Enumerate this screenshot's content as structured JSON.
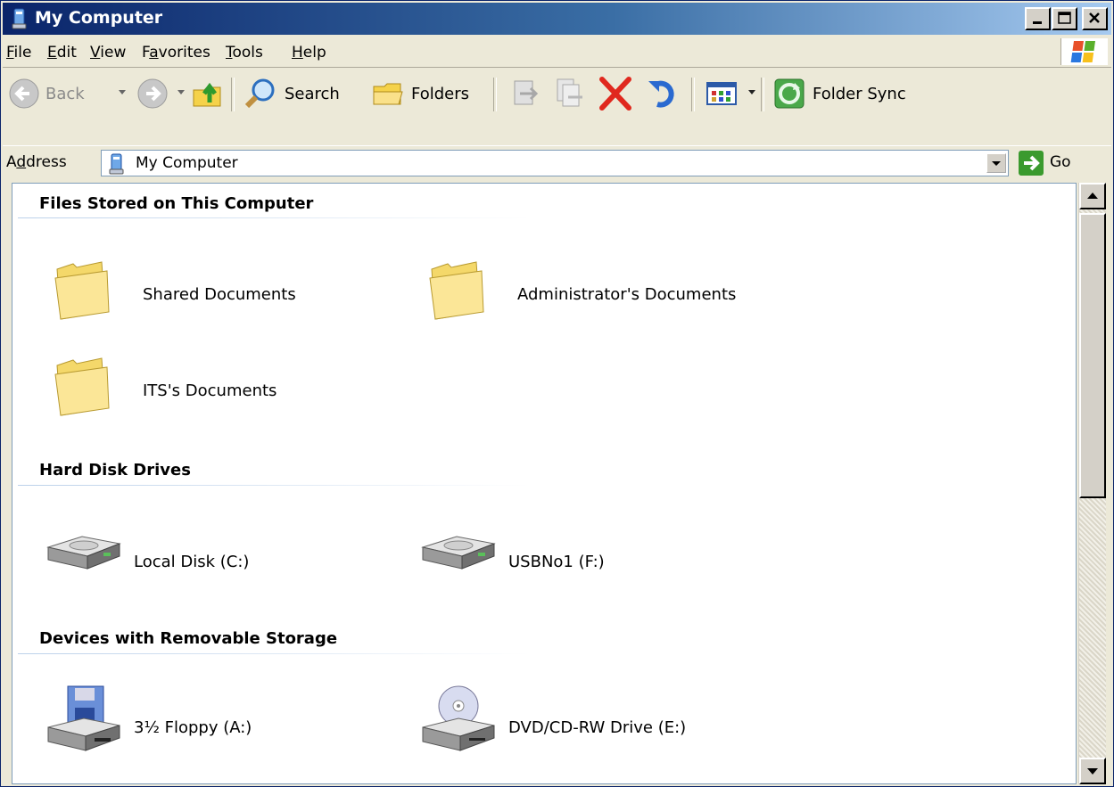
{
  "window": {
    "title": "My Computer"
  },
  "menubar": {
    "items": [
      {
        "label": "File",
        "accel": "F",
        "rest": "ile"
      },
      {
        "label": "Edit",
        "accel": "E",
        "rest": "dit"
      },
      {
        "label": "View",
        "accel": "V",
        "rest": "iew"
      },
      {
        "label": "Favorites",
        "pre": "F",
        "accel": "a",
        "rest": "vorites"
      },
      {
        "label": "Tools",
        "accel": "T",
        "rest": "ools"
      },
      {
        "label": "Help",
        "accel": "H",
        "rest": "elp"
      }
    ]
  },
  "toolbar": {
    "back_label": "Back",
    "search_label": "Search",
    "folders_label": "Folders",
    "folder_sync_label": "Folder Sync"
  },
  "address": {
    "label_pre": "A",
    "label_accel": "d",
    "label_rest": "dress",
    "value": "My Computer",
    "go_label": "Go"
  },
  "sections": [
    {
      "title": "Files Stored on This Computer",
      "items": [
        "Shared Documents",
        "Administrator's Documents",
        "ITS's Documents"
      ]
    },
    {
      "title": "Hard Disk Drives",
      "items": [
        "Local Disk (C:)",
        "USBNo1 (F:)"
      ]
    },
    {
      "title": "Devices with Removable Storage",
      "items": [
        "3½ Floppy (A:)",
        "DVD/CD-RW Drive (E:)"
      ]
    }
  ],
  "colors": {
    "titlebar_start": "#0a246a",
    "titlebar_end": "#a6caf0",
    "delete_red": "#e0281e",
    "go_green": "#3a9a2e"
  }
}
